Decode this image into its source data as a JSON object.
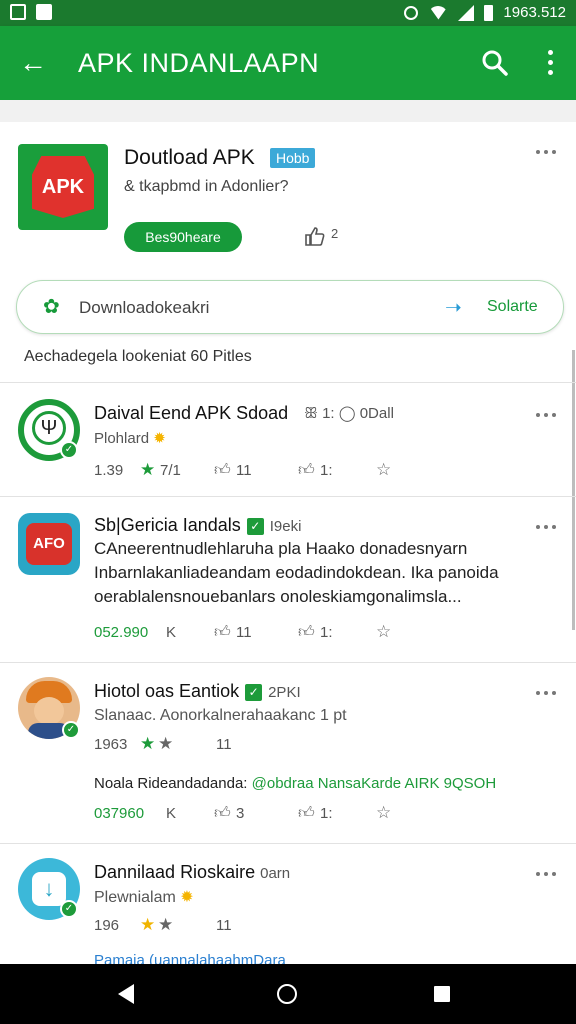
{
  "statusbar": {
    "time": "1963.512"
  },
  "appbar": {
    "title": "APK INDANLAAPN",
    "back_icon": "arrow-left-icon",
    "search_icon": "search-icon",
    "more_icon": "more-vert-icon"
  },
  "hero": {
    "icon_text": "APK",
    "title": "Doutload APK",
    "badge": "Hobb",
    "subtitle": "& tkapbmd in Adonlier?",
    "button": "Bes90heare",
    "thumb_count": "2"
  },
  "download_bar": {
    "label": "Downloadokeakri",
    "share_label": "Solarte"
  },
  "subline": "Aechadegela lookeniat 60   Pitles",
  "items": [
    {
      "title": "Daival Eend APK Sdoad",
      "meta": "ꕥ 1: ◯ 0Dall",
      "desc2": "Plohlard",
      "stats": {
        "rating": "1.39",
        "rating_sub": "7/1",
        "likes": "11",
        "comments": "1:"
      }
    },
    {
      "title": "Sb|Gericia Iandals",
      "meta": "I9eki",
      "desc_lines": [
        "CAneerentnudlehlaruha pla Haako donadesnyarn",
        "Inbarnlakanliadeandam eodadindokdean. Ika panoida",
        "oerablalensnouebanlars onoleskiamgonalimsla..."
      ],
      "stats": {
        "downloads": "052.990",
        "unit": "K",
        "likes": "11",
        "comments": "1:"
      }
    },
    {
      "title": "Hiotol oas Eantiok",
      "meta": "2PKI",
      "desc2": "Slanaac. Aonorkalnerahaakanc 1 pt",
      "stats": {
        "rating": "1963",
        "rating_sub": "11",
        "downloads": "037960",
        "unit": "K",
        "likes": "3",
        "comments": "1:"
      },
      "extra": {
        "left": "Noala Rideandadanda:",
        "link": "@obdraa",
        "right": "NansaKarde AIRK 9QSOH"
      }
    },
    {
      "title": "Dannilaad Rioskaire",
      "meta": "0arn",
      "desc2": "Plewnialam",
      "stats": {
        "rating": "196",
        "rating_sub": "11"
      },
      "cut_line": "Pamaia (uannalahaahmDara"
    }
  ]
}
